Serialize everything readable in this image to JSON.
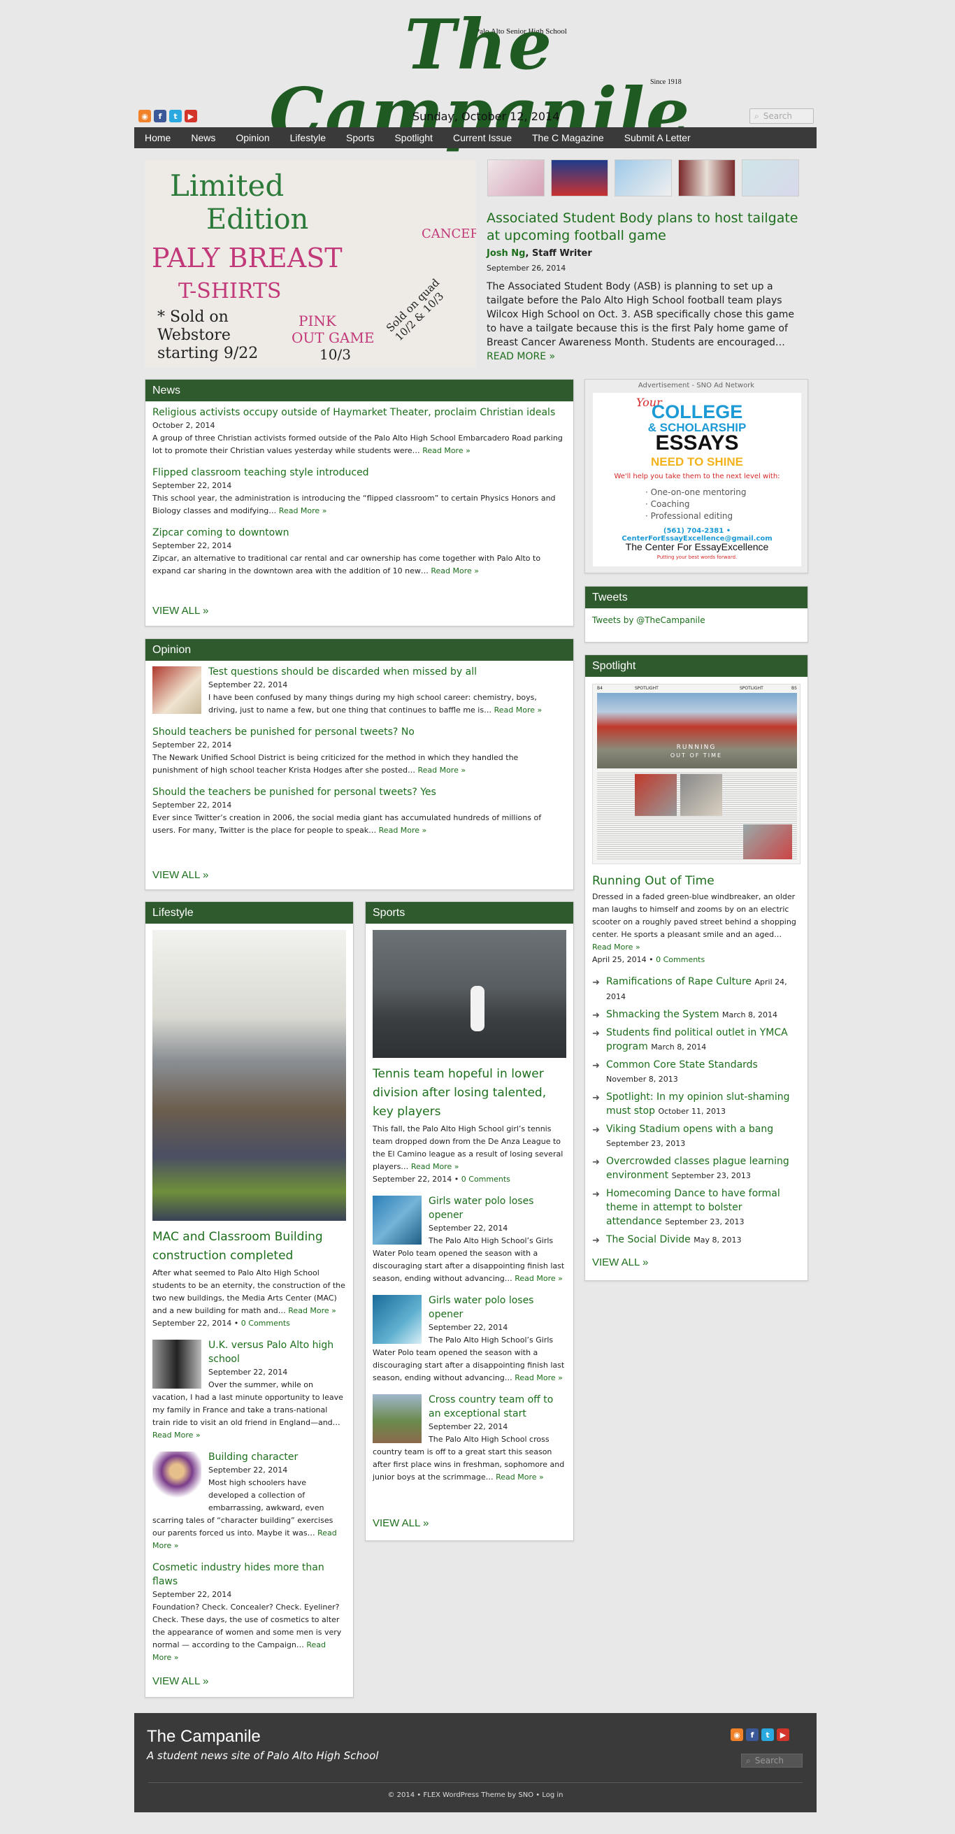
{
  "masthead": {
    "title": "The Campanile",
    "top_line": "Palo Alto Senior High School",
    "since": "Since 1918"
  },
  "social_icons": [
    "rss-icon",
    "facebook-icon",
    "twitter-icon",
    "youtube-icon"
  ],
  "dateline": "Sunday, October 12, 2014",
  "search": {
    "placeholder": "Search"
  },
  "nav": [
    "Home",
    "News",
    "Opinion",
    "Lifestyle",
    "Sports",
    "Spotlight",
    "Current Issue",
    "The C Magazine",
    "Submit A Letter"
  ],
  "featured": {
    "title": "Associated Student Body plans to host tailgate at upcoming football game",
    "author": "Josh Ng",
    "role": ", Staff Writer",
    "date": "September 26, 2014",
    "text": "The Associated Student Body (ASB) is planning to set up a tailgate before the Palo Alto High School football team plays Wilcox High School on Oct. 3. ASB specifically chose this game to have a tailgate because this is the first Paly home game of Breast Cancer Awareness Month. Students are encouraged…",
    "read_more": "READ MORE",
    "image_lines": [
      "Limited",
      "Edition",
      "PALY BREAST",
      "CANCER",
      "T-SHIRTS",
      "* Sold on",
      "Webstore",
      "starting 9/22",
      "PINK",
      "OUT GAME",
      "10/3",
      "Sold on quad 10/2 & 10/3"
    ]
  },
  "news": {
    "header": "News",
    "items": [
      {
        "title": "Religious activists occupy outside of Haymarket Theater, proclaim Christian ideals",
        "date": "October 2, 2014",
        "text": "A group of three Christian activists formed outside of the Palo Alto High School Embarcadero Road parking lot to promote their Christian values yesterday while students were…"
      },
      {
        "title": "Flipped classroom teaching style introduced",
        "date": "September 22, 2014",
        "text": "This school year, the administration is introducing the “flipped classroom” to certain Physics Honors and Biology classes and modifying…"
      },
      {
        "title": "Zipcar coming to downtown",
        "date": "September 22, 2014",
        "text": "Zipcar, an alternative to traditional car rental and car ownership has come together with Palo Alto to expand car sharing in the downtown area with the addition of 10 new…"
      }
    ],
    "read_more": "Read More »",
    "view_all": "VIEW ALL »"
  },
  "opinion": {
    "header": "Opinion",
    "items": [
      {
        "title": "Test questions should be discarded when missed by all",
        "date": "September 22, 2014",
        "text": "I have been confused by many things during my high school career: chemistry, boys, driving, just to name a few, but one thing that continues to baffle me is…"
      },
      {
        "title": "Should teachers be punished for personal tweets? No",
        "date": "September 22, 2014",
        "text": "The Newark Unified School District is being criticized for the method in which they handled the punishment of high school teacher Krista Hodges after she posted…"
      },
      {
        "title": "Should the teachers be punished for personal tweets? Yes",
        "date": "September 22, 2014",
        "text": "Ever since Twitter’s creation in 2006, the social media giant has accumulated hundreds of millions of users. For many, Twitter is the place for people to speak…"
      }
    ],
    "read_more": "Read More »",
    "view_all": "VIEW ALL »"
  },
  "lifestyle": {
    "header": "Lifestyle",
    "lead": {
      "title": "MAC and Classroom Building construction completed",
      "text": "After what seemed to Palo Alto High School students to be an eternity, the construction of the two new buildings, the Media Arts Center (MAC) and a new building for math and…",
      "date": "September 22, 2014",
      "comments": "0 Comments"
    },
    "items": [
      {
        "title": "U.K. versus Palo Alto high school",
        "date": "September 22, 2014",
        "text": "Over the summer, while on vacation, I had a last minute opportunity to leave my family in France and take a trans-national train ride to visit an old friend in England—and…"
      },
      {
        "title": "Building character",
        "date": "September 22, 2014",
        "text": "Most high schoolers have developed a collection of embarrassing, awkward, even scarring tales of “character building” exercises our parents forced us into. Maybe it was…"
      },
      {
        "title": "Cosmetic industry hides more than flaws",
        "date": "September 22, 2014",
        "text": "Foundation? Check. Concealer? Check. Eyeliner? Check. These days, the use of cosmetics to alter the appearance of women and some men is very normal — according to the Campaign…"
      }
    ],
    "read_more": "Read More »",
    "view_all": "VIEW ALL »"
  },
  "sports": {
    "header": "Sports",
    "lead": {
      "title": "Tennis team hopeful in lower division after losing talented, key players",
      "text": "This fall, the Palo Alto High School girl’s tennis team dropped down from the De Anza League to the El Camino league as a result of losing several players…",
      "date": "September 22, 2014",
      "comments": "0 Comments"
    },
    "items": [
      {
        "title": "Girls water polo loses opener",
        "date": "September 22, 2014",
        "text": "The Palo Alto High School’s Girls Water Polo team opened the season with a discouraging start after a disappointing finish last season, ending without advancing…"
      },
      {
        "title": "Girls water polo loses opener",
        "date": "September 22, 2014",
        "text": "The Palo Alto High School’s Girls Water Polo team opened the season with a discouraging start after a disappointing finish last season, ending without advancing…"
      },
      {
        "title": "Cross country team off to an exceptional start",
        "date": "September 22, 2014",
        "text": "The Palo Alto High School cross country team is off to a great start this season after first place wins in freshman, sophomore and junior boys at the scrimmage…"
      }
    ],
    "read_more": "Read More »",
    "view_all": "VIEW ALL »"
  },
  "ad": {
    "label": "Advertisement - SNO Ad Network",
    "your": "Your",
    "line1": "COLLEGE",
    "line2": "& SCHOLARSHIP",
    "line3": "ESSAYS",
    "line4": "NEED TO SHINE",
    "tagline": "We'll help you take them to the next level with:",
    "bullets": [
      "· One-on-one mentoring",
      "· Coaching",
      "· Professional editing"
    ],
    "contact": "(561) 704-2381 • CenterForEssayExcellence@gmail.com",
    "brand": "The Center For EssayExcellence",
    "brand_tag": "Putting your best words forward."
  },
  "tweets": {
    "header": "Tweets",
    "link": "Tweets by @TheCampanile"
  },
  "spotlight": {
    "header": "Spotlight",
    "image_labels": [
      "B4",
      "SPOTLIGHT",
      "SPOTLIGHT",
      "B5",
      "RUNNING",
      "OUT OF TIME"
    ],
    "title": "Running Out of Time",
    "text": "Dressed in a faded green-blue windbreaker, an older man laughs to himself and zooms by on an electric scooter on a roughly paved street behind a shopping center. He sports a pleasant smile and an aged…",
    "read_more": "Read More »",
    "date": "April 25, 2014",
    "comments": "0 Comments",
    "list": [
      {
        "title": "Ramifications of Rape Culture",
        "date": "April 24, 2014"
      },
      {
        "title": "Shmacking the System",
        "date": "March 8, 2014"
      },
      {
        "title": "Students find political outlet in YMCA program",
        "date": "March 8, 2014"
      },
      {
        "title": "Common Core State Standards",
        "date": "November 8, 2013"
      },
      {
        "title": "Spotlight: In my opinion slut-shaming must stop",
        "date": "October 11, 2013"
      },
      {
        "title": "Viking Stadium opens with a bang",
        "date": "September 23, 2013"
      },
      {
        "title": "Overcrowded classes plague learning environment",
        "date": "September 23, 2013"
      },
      {
        "title": "Homecoming Dance to have formal theme in attempt to bolster attendance",
        "date": "September 23, 2013"
      },
      {
        "title": "The Social Divide",
        "date": "May 8, 2013"
      }
    ],
    "view_all": "VIEW ALL »"
  },
  "footer": {
    "title": "The Campanile",
    "subtitle": "A student news site of Palo Alto High School",
    "search_placeholder": "Search",
    "copyright": "© 2014 • FLEX WordPress Theme by SNO • Log in"
  },
  "colors": {
    "accent_green": "#1d6e1d",
    "header_green": "#2f5a2d",
    "nav_bg": "#3a3a3a"
  }
}
